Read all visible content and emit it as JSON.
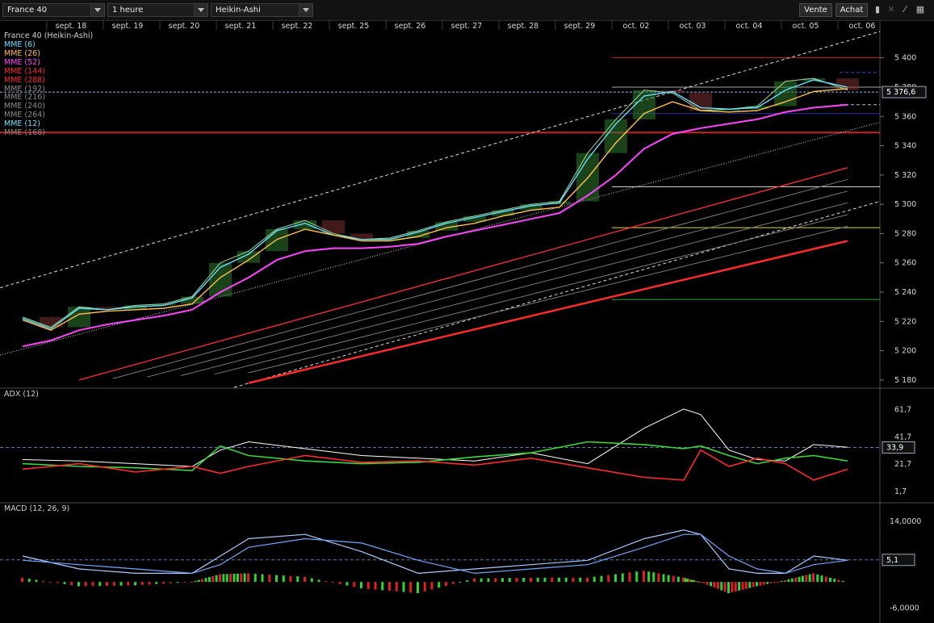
{
  "toolbar": {
    "instrument": "France 40",
    "timeframe": "1 heure",
    "chart_type": "Heikin-Ashi",
    "sell_label": "Vente",
    "buy_label": "Achat",
    "icons": [
      "bar-chart-icon",
      "indicator-icon",
      "trend-icon",
      "chart-settings-icon"
    ]
  },
  "legend": {
    "title": "France 40 (Heikin-Ashi)",
    "items": [
      {
        "label": "MME (6)",
        "color": "#66e0ff"
      },
      {
        "label": "MME (26)",
        "color": "#ffc04a"
      },
      {
        "label": "MME (52)",
        "color": "#ff44ff"
      },
      {
        "label": "MME (144)",
        "color": "#ff2a2a"
      },
      {
        "label": "MME (288)",
        "color": "#ff2a2a"
      },
      {
        "label": "MME (192)",
        "color": "#8a8a8a"
      },
      {
        "label": "MME (216)",
        "color": "#8a8a8a"
      },
      {
        "label": "MME (240)",
        "color": "#8a8a8a"
      },
      {
        "label": "MME (264)",
        "color": "#8a8a8a"
      },
      {
        "label": "MME (12)",
        "color": "#66e0ff"
      },
      {
        "label": "MME (168)",
        "color": "#8a8a8a"
      }
    ]
  },
  "panels": {
    "adx_title": "ADX (12)",
    "macd_title": "MACD (12, 26, 9)"
  },
  "chart_data": [
    {
      "type": "line",
      "title": "France 40 (Heikin-Ashi)",
      "x_labels": [
        "sept. 18",
        "sept. 19",
        "sept. 20",
        "sept. 21",
        "sept. 22",
        "sept. 25",
        "sept. 26",
        "sept. 27",
        "sept. 28",
        "sept. 29",
        "oct. 02",
        "oct. 03",
        "oct. 04",
        "oct. 05",
        "oct. 06"
      ],
      "y_ticks": [
        5180,
        5200,
        5220,
        5240,
        5260,
        5280,
        5300,
        5320,
        5340,
        5360,
        5380,
        5400
      ],
      "ylim": [
        5175,
        5418
      ],
      "last_price": "5 376,6",
      "series": [
        {
          "name": "Heikin-Ashi close",
          "color": "#9ed99e",
          "x": [
            0,
            0.5,
            1,
            1.5,
            2,
            2.5,
            3,
            3.5,
            4,
            4.5,
            5,
            5.5,
            6,
            6.5,
            7,
            7.5,
            8,
            8.5,
            9,
            9.5,
            10,
            10.5,
            11,
            11.5,
            12,
            12.5,
            13,
            13.5,
            14,
            14.6
          ],
          "values": [
            5223,
            5216,
            5230,
            5228,
            5231,
            5232,
            5237,
            5260,
            5268,
            5283,
            5289,
            5280,
            5276,
            5277,
            5282,
            5288,
            5292,
            5296,
            5300,
            5302,
            5335,
            5358,
            5378,
            5376,
            5364,
            5365,
            5367,
            5384,
            5386,
            5378
          ]
        },
        {
          "name": "MME (6)",
          "color": "#66e0ff",
          "x": [
            0,
            0.5,
            1,
            1.5,
            2,
            2.5,
            3,
            3.5,
            4,
            4.5,
            5,
            5.5,
            6,
            6.5,
            7,
            7.5,
            8,
            8.5,
            9,
            9.5,
            10,
            10.5,
            11,
            11.5,
            12,
            12.5,
            13,
            13.5,
            14,
            14.6
          ],
          "values": [
            5222,
            5215,
            5229,
            5228,
            5230,
            5231,
            5236,
            5257,
            5266,
            5282,
            5287,
            5279,
            5276,
            5276,
            5281,
            5287,
            5291,
            5295,
            5299,
            5301,
            5331,
            5355,
            5374,
            5377,
            5366,
            5365,
            5366,
            5378,
            5385,
            5380
          ]
        },
        {
          "name": "MME (26)",
          "color": "#ffc04a",
          "x": [
            0,
            0.5,
            1,
            1.5,
            2,
            2.5,
            3,
            3.5,
            4,
            4.5,
            5,
            5.5,
            6,
            6.5,
            7,
            7.5,
            8,
            8.5,
            9,
            9.5,
            10,
            10.5,
            11,
            11.5,
            12,
            12.5,
            13,
            13.5,
            14,
            14.6
          ],
          "values": [
            5221,
            5214,
            5225,
            5227,
            5228,
            5229,
            5232,
            5250,
            5262,
            5276,
            5283,
            5279,
            5275,
            5275,
            5278,
            5284,
            5287,
            5292,
            5296,
            5298,
            5318,
            5342,
            5362,
            5370,
            5364,
            5363,
            5364,
            5370,
            5377,
            5379
          ]
        },
        {
          "name": "MME (52)",
          "color": "#ff44ff",
          "x": [
            0,
            0.5,
            1,
            1.5,
            2,
            2.5,
            3,
            3.5,
            4,
            4.5,
            5,
            5.5,
            6,
            6.5,
            7,
            7.5,
            8,
            8.5,
            9,
            9.5,
            10,
            10.5,
            11,
            11.5,
            12,
            12.5,
            13,
            13.5,
            14,
            14.6
          ],
          "values": [
            5203,
            5207,
            5214,
            5218,
            5221,
            5224,
            5228,
            5240,
            5250,
            5262,
            5268,
            5270,
            5270,
            5271,
            5273,
            5278,
            5282,
            5286,
            5290,
            5294,
            5306,
            5320,
            5338,
            5348,
            5352,
            5355,
            5358,
            5363,
            5366,
            5368
          ]
        },
        {
          "name": "MME (144)",
          "color": "#ff2a2a",
          "x": [
            1,
            14.6
          ],
          "values": [
            5180,
            5325
          ]
        },
        {
          "name": "MME (288)",
          "color": "#ff2a2a",
          "x": [
            4,
            14.6
          ],
          "values": [
            5178,
            5275
          ]
        }
      ],
      "horizontal_levels": [
        5400,
        5390,
        5380,
        5368,
        5362,
        5349,
        5312,
        5284,
        5235
      ],
      "grid": false
    },
    {
      "type": "line",
      "title": "ADX (12)",
      "y_ticks": [
        1.7,
        21.7,
        41.7,
        61.7
      ],
      "ylim": [
        -6,
        72
      ],
      "reference_level": "33,9",
      "series": [
        {
          "name": "ADX",
          "color": "#ffffff",
          "x": [
            0,
            1,
            2,
            3,
            3.5,
            4,
            5,
            6,
            7,
            8,
            9,
            10,
            11,
            11.7,
            12,
            12.5,
            13,
            13.5,
            14,
            14.6
          ],
          "values": [
            25,
            24,
            22,
            20,
            32,
            38,
            33,
            28,
            26,
            24,
            30,
            22,
            48,
            62,
            58,
            32,
            25,
            24,
            36,
            34
          ]
        },
        {
          "name": "+DI",
          "color": "#39d839",
          "x": [
            0,
            1,
            2,
            3,
            3.5,
            4,
            5,
            6,
            7,
            8,
            9,
            10,
            11,
            11.7,
            12,
            12.5,
            13,
            13.5,
            14,
            14.6
          ],
          "values": [
            22,
            20,
            19,
            17,
            35,
            28,
            24,
            22,
            23,
            27,
            30,
            38,
            36,
            33,
            35,
            28,
            22,
            26,
            28,
            24
          ]
        },
        {
          "name": "-DI",
          "color": "#ff2a2a",
          "x": [
            0,
            1,
            2,
            3,
            3.5,
            4,
            5,
            6,
            7,
            8,
            9,
            10,
            11,
            11.7,
            12,
            12.5,
            13,
            13.5,
            14,
            14.6
          ],
          "values": [
            18,
            22,
            16,
            20,
            15,
            20,
            28,
            23,
            24,
            21,
            26,
            19,
            12,
            10,
            32,
            20,
            26,
            22,
            10,
            18
          ]
        }
      ]
    },
    {
      "type": "line",
      "title": "MACD (12, 26, 9)",
      "y_ticks": [
        14.0,
        -6.0
      ],
      "ylim": [
        -8,
        17
      ],
      "reference_level": "5,1",
      "series": [
        {
          "name": "MACD",
          "color": "#a9c9ff",
          "x": [
            0,
            1,
            2,
            3,
            3.5,
            4,
            5,
            6,
            7,
            8,
            9,
            10,
            11,
            11.7,
            12,
            12.5,
            13,
            13.5,
            14,
            14.6
          ],
          "values": [
            6,
            3,
            2,
            2,
            6,
            10,
            11,
            7,
            2,
            3,
            4,
            5,
            10,
            12,
            11,
            3,
            2,
            2,
            6,
            5
          ]
        },
        {
          "name": "Signal",
          "color": "#6fa8ff",
          "x": [
            0,
            1,
            2,
            3,
            3.5,
            4,
            5,
            6,
            7,
            8,
            9,
            10,
            11,
            11.7,
            12,
            12.5,
            13,
            13.5,
            14,
            14.6
          ],
          "values": [
            5,
            4,
            3,
            2,
            4,
            8,
            10,
            9,
            5,
            2,
            3,
            4,
            8,
            11,
            11,
            6,
            3,
            2,
            4,
            5
          ]
        },
        {
          "name": "Histogram",
          "color": "#ff2a2a",
          "x": [
            0,
            1,
            2,
            3,
            3.5,
            4,
            5,
            6,
            7,
            8,
            9,
            10,
            11,
            11.7,
            12,
            12.5,
            13,
            13.5,
            14,
            14.6
          ],
          "values": [
            1,
            -1,
            -0.8,
            0,
            1.8,
            2,
            1.2,
            -1.5,
            -2.6,
            0.8,
            1,
            1,
            2.6,
            1,
            0,
            -2.6,
            -1,
            0.4,
            2,
            0
          ]
        }
      ]
    }
  ]
}
